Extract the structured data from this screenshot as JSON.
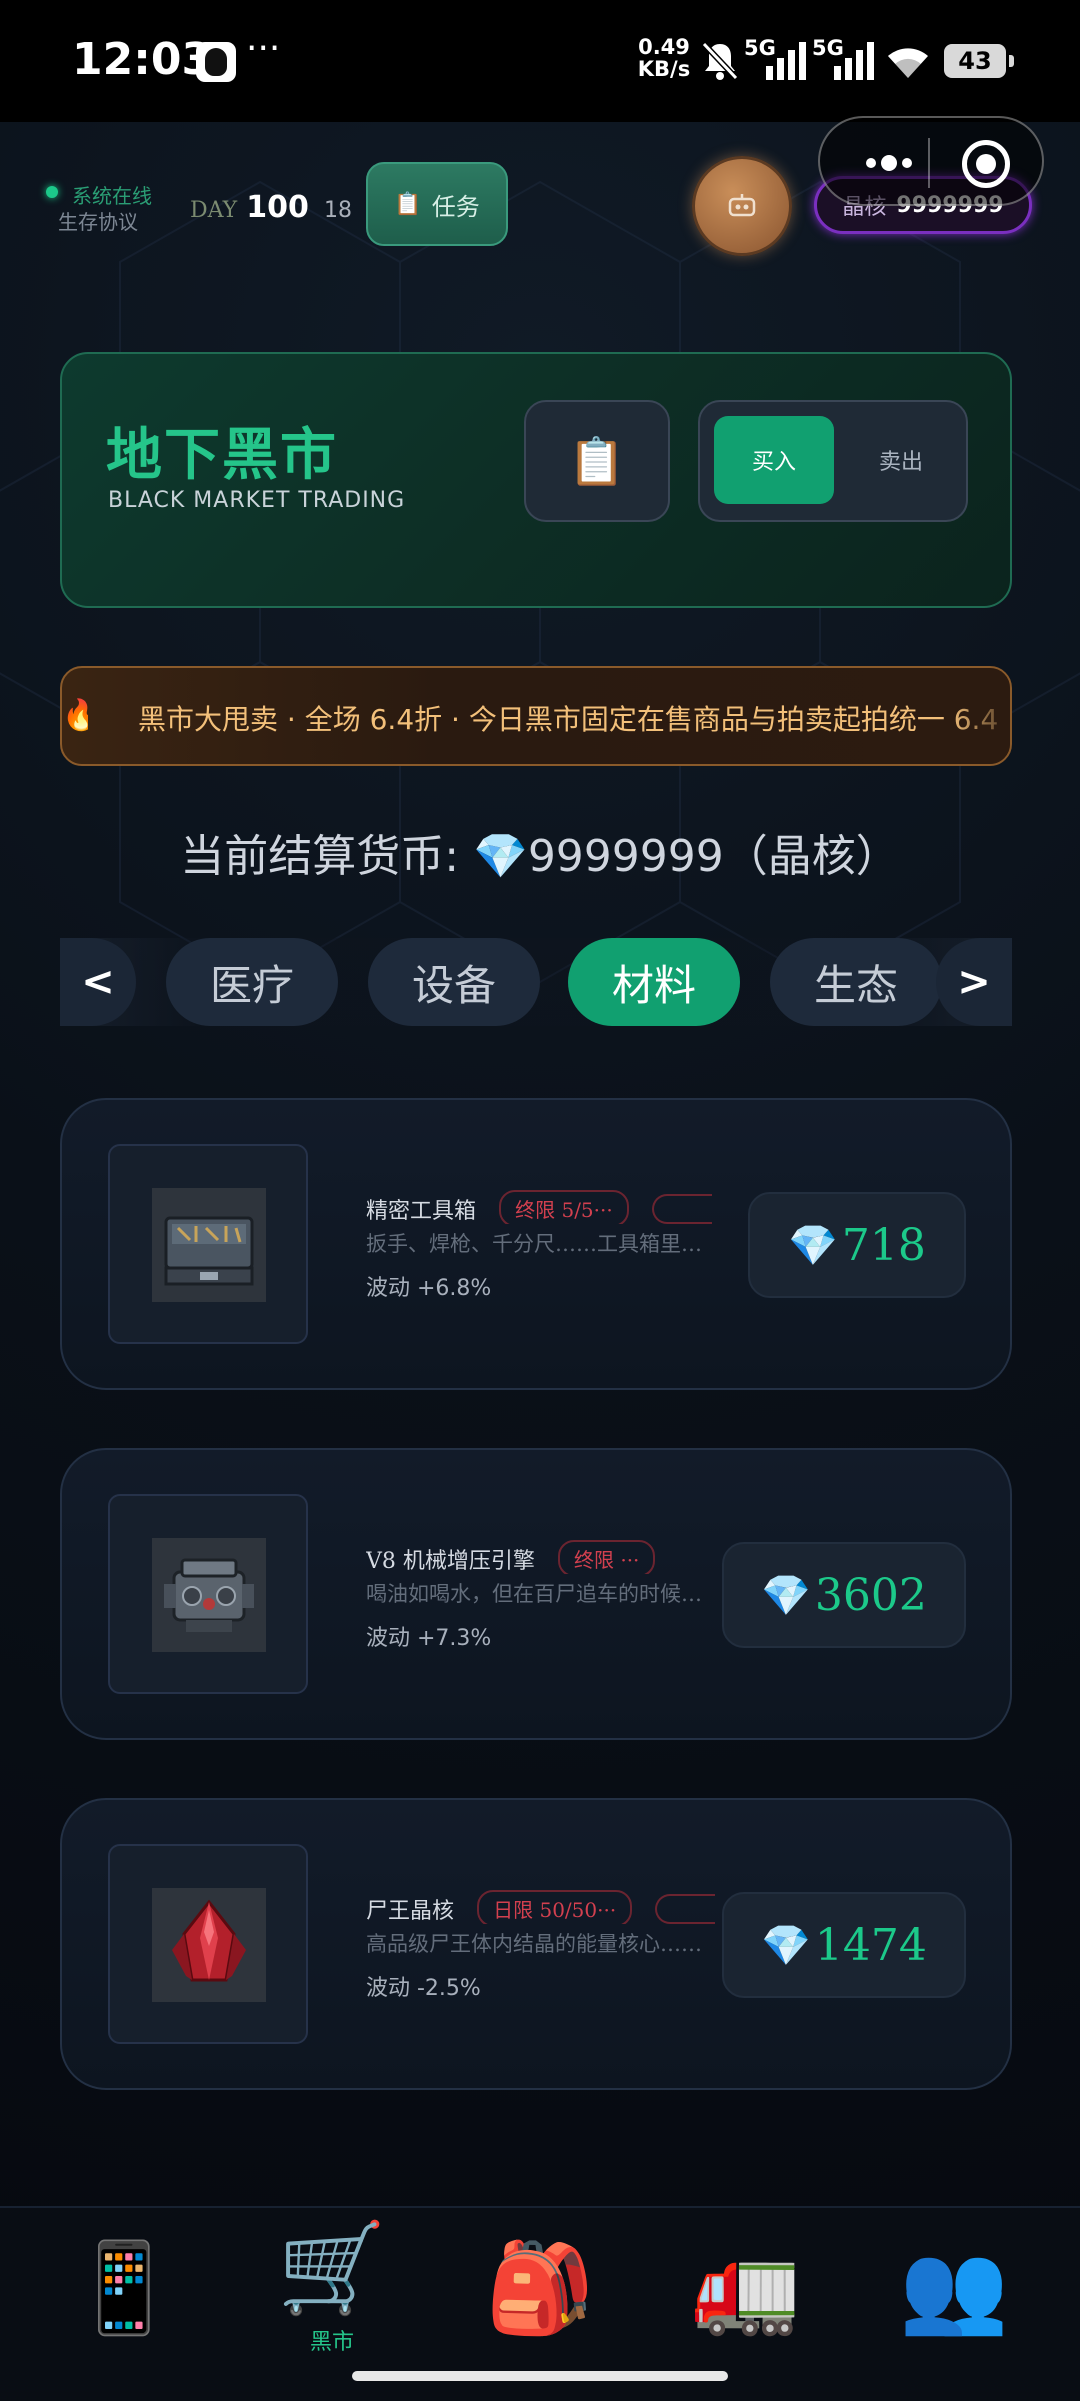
{
  "status_bar": {
    "time": "12:03",
    "more": "···",
    "net_speed_value": "0.49",
    "net_speed_unit": "KB/s",
    "sim1": "5G",
    "sim2": "5G",
    "battery": "43"
  },
  "top_bar": {
    "online_label": "系统在线",
    "protocol_label": "生存协议",
    "day_label": "DAY",
    "day_value": "100",
    "day_sub": "18",
    "task_label": "任务",
    "crystal_label": "晶核",
    "crystal_value": "9999999"
  },
  "header": {
    "title": "地下黑市",
    "subtitle": "BLACK MARKET TRADING",
    "buy_label": "买入",
    "sell_label": "卖出"
  },
  "ticker": {
    "text": "黑市大甩卖 · 全场 6.4折 · 今日黑市固定在售商品与拍卖起拍统一 6.4"
  },
  "currency": {
    "text": "当前结算货币: 💎9999999（晶核）"
  },
  "tabs": {
    "left_partial": "<",
    "items": [
      "医疗",
      "设备",
      "材料",
      "生态"
    ],
    "active": "材料",
    "prev": "<",
    "next": ">"
  },
  "items": [
    {
      "name": "精密工具箱",
      "limit": "终限 5/5···",
      "desc": "扳手、焊枪、千分尺……工具箱里装着重建文明的…",
      "volatility": "波动 +6.8%",
      "price": "718",
      "icon": "toolbox"
    },
    {
      "name": "V8 机械增压引擎",
      "limit": "终限 ···",
      "desc": "喝油如喝水，但在百尸追车的时候……",
      "volatility": "波动 +7.3%",
      "price": "3602",
      "icon": "engine"
    },
    {
      "name": "尸王晶核",
      "limit": "日限 50/50···",
      "desc": "高品级尸王体内结晶的能量核心……",
      "volatility": "波动 -2.5%",
      "price": "1474",
      "icon": "red-crystal"
    }
  ],
  "bottom_nav": {
    "items": [
      {
        "icon": "phone-icon",
        "label": ""
      },
      {
        "icon": "cart-icon",
        "label": "黑市"
      },
      {
        "icon": "backpack-icon",
        "label": ""
      },
      {
        "icon": "truck-icon",
        "label": ""
      },
      {
        "icon": "people-icon",
        "label": ""
      }
    ]
  },
  "colors": {
    "accent_green": "#11a070",
    "crystal_green": "#1cc98a",
    "ticker_text": "#f3c07a",
    "limit_red": "#d3404f",
    "crystal_purple": "#7a2fbf"
  }
}
